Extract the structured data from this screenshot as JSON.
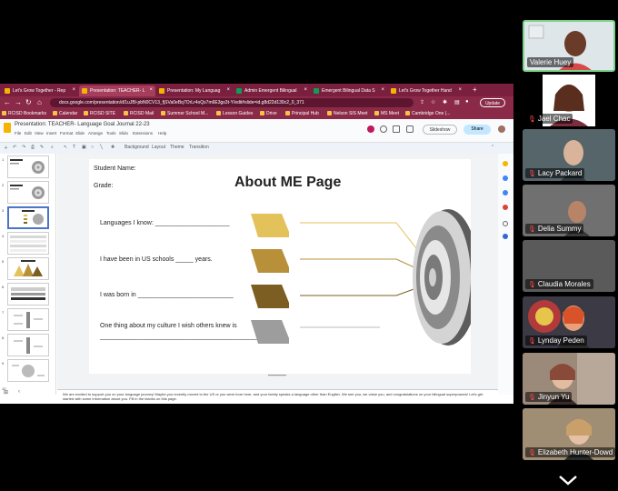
{
  "browser": {
    "tabs": [
      {
        "label": "Let's Grow Together - Rep",
        "icon": "drive-icon"
      },
      {
        "label": "Presentation: TEACHER- L",
        "icon": "slides-icon",
        "active": true
      },
      {
        "label": "Presentation: My Languag",
        "icon": "slides-icon"
      },
      {
        "label": "Admin Emergent Bilingual",
        "icon": "sheets-icon"
      },
      {
        "label": "Emergent Bilingual Data S",
        "icon": "sheets-icon"
      },
      {
        "label": "Let's Grow Together Hand",
        "icon": "slides-icon"
      }
    ],
    "new_tab": "+",
    "url": "docs.google.com/presentation/d/1uJBl-pbN0CV13_fjSVa0eBq7OrLr4oQs7m6E3gs3t-Y/edit#slide=id.g8d22d139c2_0_371",
    "update_label": "Update",
    "bookmarks": [
      "RCISD Bookmarks",
      "Calendar",
      "RCISD SITE",
      "RCISD Mail",
      "Summer School M...",
      "Lesson Guides",
      "Drive",
      "Principal Hub",
      "Nelson SIS Meet",
      "MS Meet",
      "Cambridge One (..."
    ]
  },
  "doc": {
    "title": "Presentation: TEACHER- Language Goal Journal 22-23",
    "menu": [
      "File",
      "Edit",
      "View",
      "Insert",
      "Format",
      "Slide",
      "Arrange",
      "Tools",
      "Slido",
      "Extensions",
      "Help"
    ],
    "slideshow_label": "Slideshow",
    "share_label": "Share",
    "toolbar_items": [
      "Background",
      "Layout",
      "Theme",
      "Transition"
    ]
  },
  "filmstrip": {
    "numbers": [
      "1",
      "2",
      "3",
      "4",
      "5",
      "6",
      "7",
      "8",
      "9",
      "10"
    ]
  },
  "slide": {
    "title": "About ME Page",
    "student_name": "Student Name:",
    "grade": "Grade:",
    "languages": "Languages I know: _____________________",
    "us_schools": "I have been in US schools _____ years.",
    "born": "I was born in ___________________________",
    "culture": "One thing about my culture I wish others knew is",
    "culture_line": "______________________________________________"
  },
  "notes": {
    "text": "We are excited to support you on your language journey! Maybe you recently moved to the US or you were born here, and your family speaks a language other than English. We see you, we value you, and congratulations on your bilingual superpowers! Let's get started with some information about you. Fill in the blanks on this page."
  },
  "participants": [
    {
      "name": "Valerie Huey",
      "muted": false,
      "speaking": true,
      "bg": "#c9d6df"
    },
    {
      "name": "Jael Chac",
      "muted": true,
      "bg": "#ffffff"
    },
    {
      "name": "Lacy Packard",
      "muted": true,
      "bg": "#4a5a5e"
    },
    {
      "name": "Delia Summy",
      "muted": true,
      "bg": "#6b6b6b"
    },
    {
      "name": "Claudia Morales",
      "muted": true,
      "bg": "#555555"
    },
    {
      "name": "Lynday Peden",
      "muted": true,
      "bg": "#3c3a44"
    },
    {
      "name": "Jinyun Yu",
      "muted": true,
      "bg": "#8a7a6e"
    },
    {
      "name": "Elizabeth Hunter-Dowd",
      "muted": true,
      "bg": "#8c7c66"
    }
  ],
  "colors": {
    "tab_bar": "#7a1f3d",
    "arrow_1": "#e3c25c",
    "arrow_2": "#b8903a",
    "arrow_3": "#7d5e22",
    "arrow_4": "#9d9d9d",
    "speaking_border": "#7bd389"
  }
}
